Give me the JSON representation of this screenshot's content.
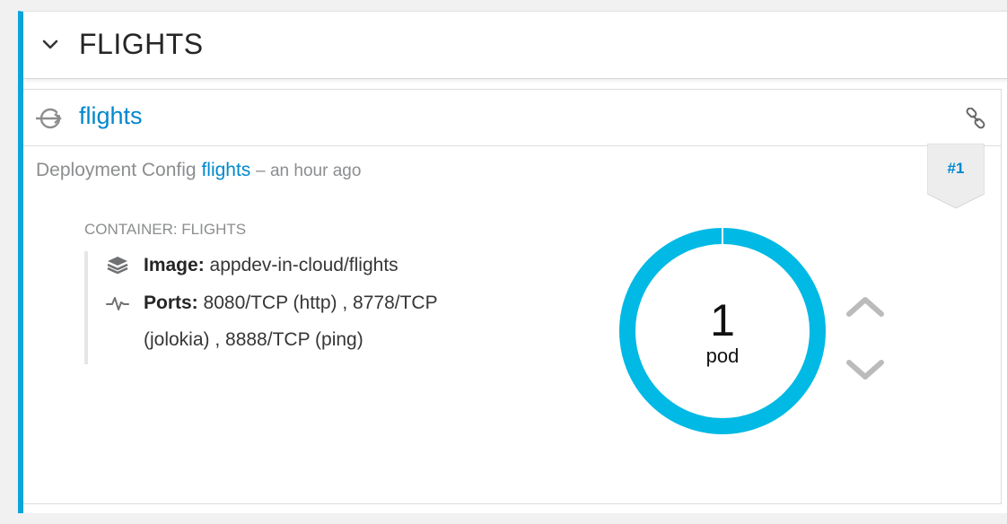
{
  "group": {
    "title": "FLIGHTS",
    "toggle_icon": "chevron-down-icon"
  },
  "service": {
    "icon": "service-icon",
    "name": "flights",
    "link_icon": "link-icon"
  },
  "deployment": {
    "prefix": "Deployment Config",
    "name": "flights",
    "age": "– an hour ago",
    "badge": "#1"
  },
  "container": {
    "heading": "CONTAINER: FLIGHTS",
    "image_label": "Image:",
    "image_value": "appdev-in-cloud/flights",
    "ports_label": "Ports:",
    "ports_value": "8080/TCP (http) , 8778/TCP (jolokia) , 8888/TCP (ping)",
    "image_icon": "layers-icon",
    "ports_icon": "pulse-icon"
  },
  "pods": {
    "count": "1",
    "label": "pod",
    "ring_color": "#00b9e4",
    "scale_up_icon": "chevron-up-icon",
    "scale_down_icon": "chevron-down-icon"
  },
  "colors": {
    "accent": "#0aa5dc",
    "link": "#0088ce",
    "muted": "#8b8d8f"
  }
}
